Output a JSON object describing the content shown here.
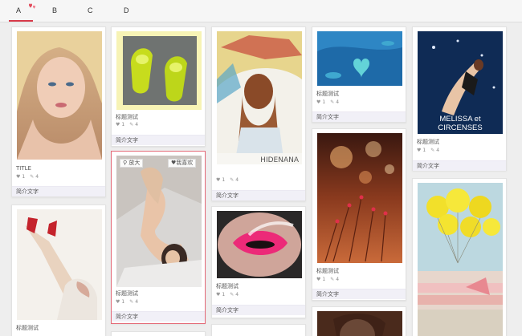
{
  "tabs": [
    {
      "label": "A",
      "active": true
    },
    {
      "label": "B",
      "active": false
    },
    {
      "label": "C",
      "active": false
    },
    {
      "label": "D",
      "active": false
    }
  ],
  "accent_color": "#d83a4a",
  "cards": [
    {
      "name": "card-blonde-portrait",
      "title": "TITLE",
      "likes": "1",
      "comments": "4",
      "desc": "简介文字"
    },
    {
      "name": "card-green-shoes",
      "title": "标题测试",
      "likes": "1",
      "comments": "4",
      "desc": "简介文字"
    },
    {
      "name": "card-carousel-girl",
      "title": "",
      "likes": "1",
      "comments": "4",
      "desc": "简介文字"
    },
    {
      "name": "card-heart-reef",
      "title": "标题测试",
      "likes": "1",
      "comments": "4",
      "desc": "简介文字"
    },
    {
      "name": "card-melissa-poster",
      "title": "标题测试",
      "likes": "1",
      "comments": "4",
      "desc": "简介文字"
    },
    {
      "name": "card-red-shoes",
      "title": "标题测试",
      "likes": "",
      "comments": "",
      "desc": ""
    },
    {
      "name": "card-woman-on-bed",
      "title": "标题测试",
      "likes": "1",
      "comments": "4",
      "desc": "简介文字"
    },
    {
      "name": "card-pink-lips",
      "title": "标题测试",
      "likes": "1",
      "comments": "4",
      "desc": "简介文字"
    },
    {
      "name": "card-bokeh-flowers",
      "title": "标题测试",
      "likes": "1",
      "comments": "4",
      "desc": "简介文字"
    },
    {
      "name": "card-yellow-balloons",
      "title": "",
      "likes": "",
      "comments": "",
      "desc": ""
    },
    {
      "name": "card-portrait-bottom",
      "title": "",
      "likes": "",
      "comments": "",
      "desc": ""
    },
    {
      "name": "card-partial-bottom",
      "title": "",
      "likes": "",
      "comments": "",
      "desc": ""
    }
  ],
  "overlay": {
    "zoom_label": "放大",
    "like_label": "我喜欢"
  },
  "image_texts": {
    "carousel_caption": "HIDENANA",
    "poster_line1": "MELISSA et",
    "poster_line2": "CIRCENSES"
  }
}
